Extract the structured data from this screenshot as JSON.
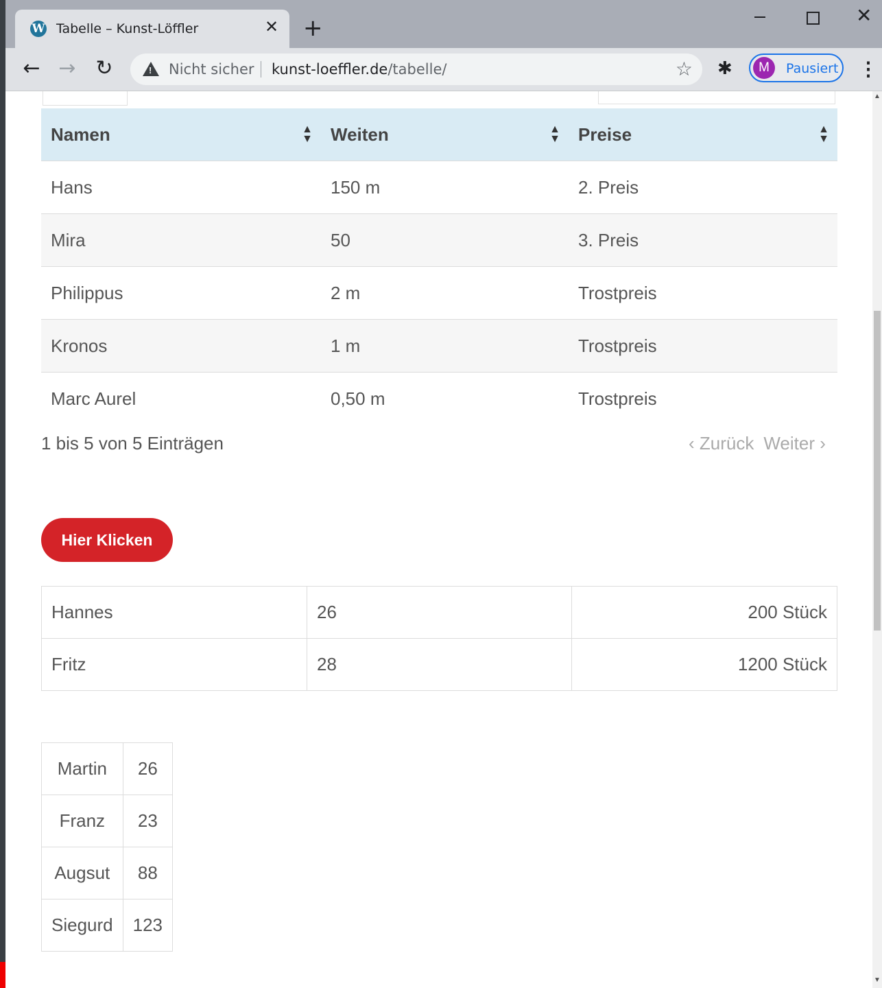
{
  "browser": {
    "tab_title": "Tabelle – Kunst-Löffler",
    "tab_favicon": "W",
    "close_glyph": "✕",
    "new_tab_glyph": "+",
    "back_glyph": "←",
    "forward_glyph": "→",
    "reload_glyph": "↻",
    "security_label": "Nicht sicher",
    "url_host": "kunst-loeffler.de",
    "url_path": "/tabelle/",
    "star_glyph": "☆",
    "extensions_glyph": "✱",
    "profile_initial": "M",
    "profile_label": "Pausiert",
    "menu_glyph": "⋮",
    "window_close_glyph": "✕",
    "icons": [
      "wordpress-icon",
      "close-icon",
      "plus-icon",
      "back-arrow-icon",
      "forward-arrow-icon",
      "reload-icon",
      "warning-icon",
      "star-icon",
      "puzzle-icon",
      "menu-icon",
      "minimize-icon",
      "maximize-icon"
    ]
  },
  "table1": {
    "headers": [
      "Namen",
      "Weiten",
      "Preise"
    ],
    "sort_glyph": "▲\n▼",
    "rows": [
      [
        "Hans",
        "150 m",
        "2. Preis"
      ],
      [
        "Mira",
        "50",
        "3. Preis"
      ],
      [
        "Philippus",
        "2 m",
        "Trostpreis"
      ],
      [
        "Kronos",
        "1 m",
        "Trostpreis"
      ],
      [
        "Marc Aurel",
        "0,50 m",
        "Trostpreis"
      ]
    ],
    "info": "1 bis 5 von 5 Einträgen",
    "prev_label": "‹ Zurück",
    "next_label": "Weiter ›"
  },
  "button": {
    "label": "Hier Klicken",
    "color": "#d42328"
  },
  "table2": {
    "rows": [
      [
        "Hannes",
        "26",
        "200 Stück"
      ],
      [
        "Fritz",
        "28",
        "1200 Stück"
      ]
    ]
  },
  "table3": {
    "rows": [
      [
        "Martin",
        "26"
      ],
      [
        "Franz",
        "23"
      ],
      [
        "Augsut",
        "88"
      ],
      [
        "Siegurd",
        "123"
      ]
    ]
  }
}
